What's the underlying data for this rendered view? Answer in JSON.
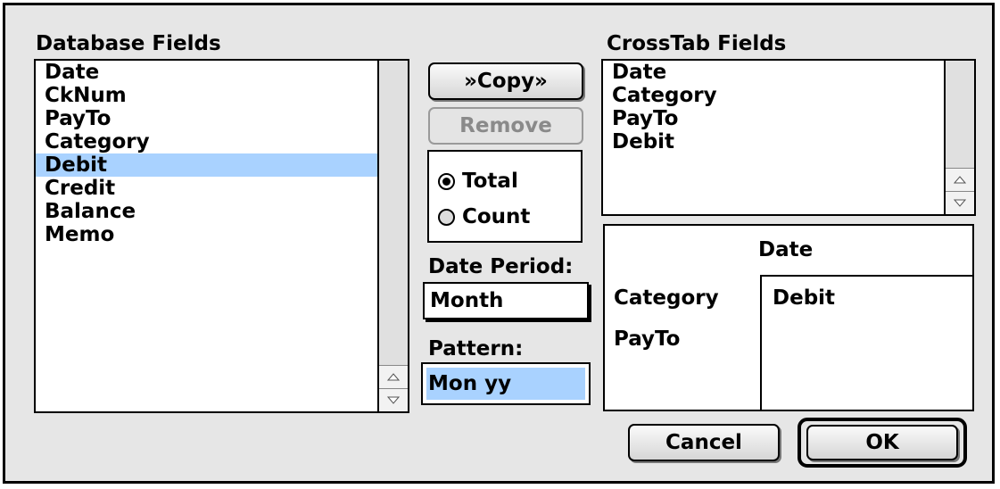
{
  "database_fields": {
    "title": "Database Fields",
    "items": [
      "Date",
      "CkNum",
      "PayTo",
      "Category",
      "Debit",
      "Credit",
      "Balance",
      "Memo"
    ],
    "selected": "Debit"
  },
  "buttons": {
    "copy": "»Copy»",
    "remove": "Remove",
    "cancel": "Cancel",
    "ok": "OK"
  },
  "summary": {
    "options": [
      "Total",
      "Count"
    ],
    "selected": "Total"
  },
  "date_period": {
    "label": "Date Period:",
    "value": "Month"
  },
  "pattern": {
    "label": "Pattern:",
    "value": "Mon yy"
  },
  "crosstab_fields": {
    "title": "CrossTab Fields",
    "items": [
      "Date",
      "Category",
      "PayTo",
      "Debit"
    ]
  },
  "layout_preview": {
    "column_field": "Date",
    "row_fields": [
      "Category",
      "PayTo"
    ],
    "data_field": "Debit"
  },
  "colors": {
    "selection": "#a9d2ff"
  }
}
